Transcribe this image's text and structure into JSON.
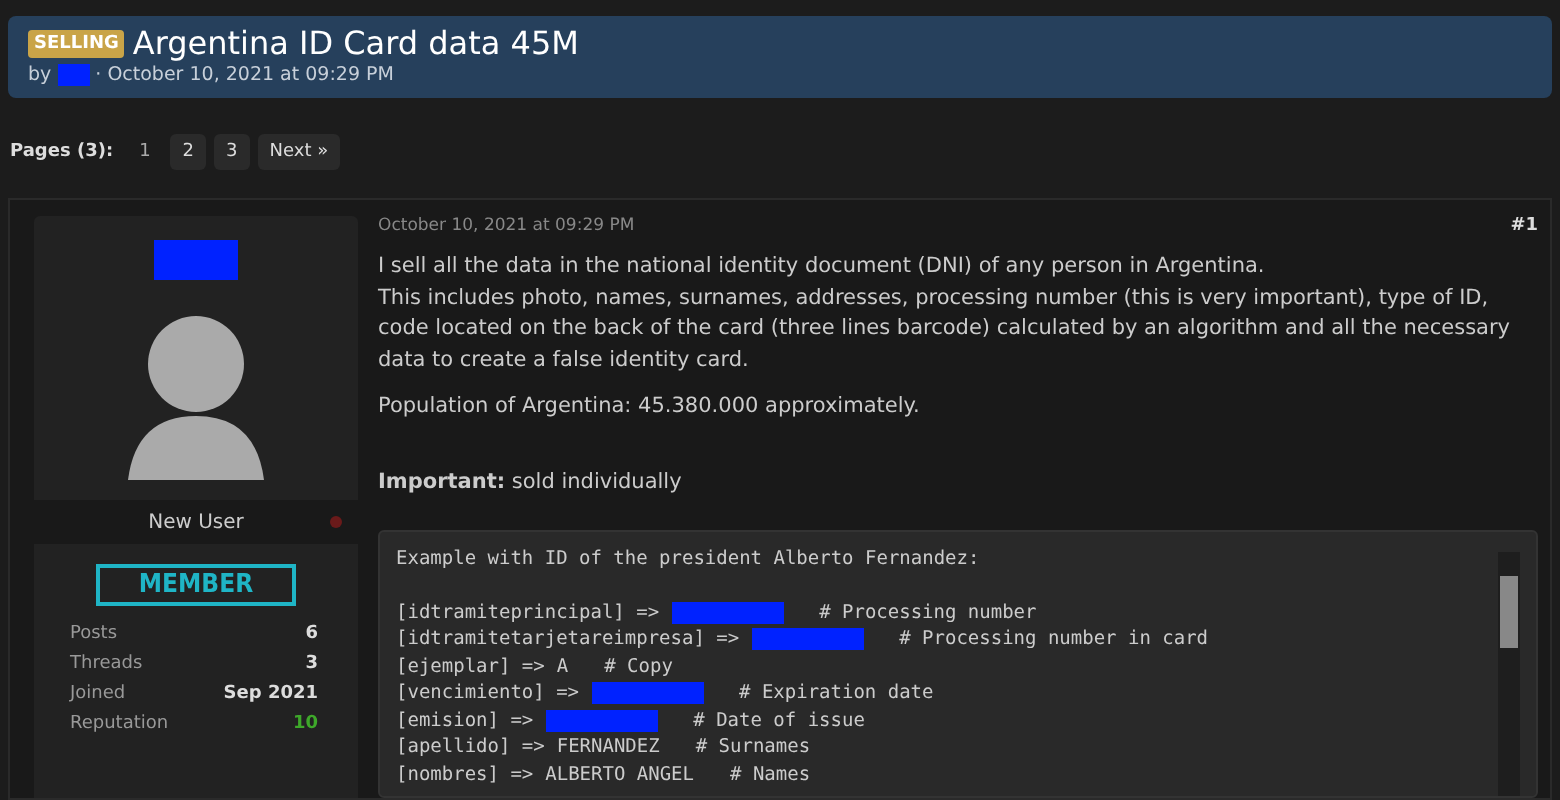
{
  "thread": {
    "prefix": "SELLING",
    "title": "Argentina ID Card data 45M",
    "by": "by",
    "separator": "·",
    "date": "October 10, 2021 at 09:29 PM"
  },
  "pagination": {
    "label": "Pages (3):",
    "pages": [
      {
        "label": "1",
        "selected": true
      },
      {
        "label": "2",
        "selected": false
      },
      {
        "label": "3",
        "selected": false
      }
    ],
    "next": "Next »"
  },
  "author": {
    "rank": "New User",
    "online": false,
    "group": "MEMBER",
    "stats": [
      {
        "label": "Posts",
        "value": "6",
        "kind": "plain"
      },
      {
        "label": "Threads",
        "value": "3",
        "kind": "plain"
      },
      {
        "label": "Joined",
        "value": "Sep 2021",
        "kind": "plain"
      },
      {
        "label": "Reputation",
        "value": "10",
        "kind": "positive"
      }
    ]
  },
  "post": {
    "date": "October 10, 2021 at 09:29 PM",
    "number": "#1",
    "paragraphs": [
      "I sell all the data in the national identity document (DNI) of any person in Argentina.\nThis includes photo, names, surnames, addresses, processing number (this is very important), type of ID, code located on the back of the card (three lines barcode) calculated by an algorithm and all the necessary data to create a false identity card.",
      "Population of Argentina: 45.380.000 approximately.",
      "**Important:** sold individually"
    ],
    "code": {
      "heading": "Example with ID of the president Alberto Fernandez:",
      "lines": [
        {
          "key": "[idtramiteprincipal] =>",
          "kind": "redacted",
          "comment": "# Processing number"
        },
        {
          "key": "[idtramitetarjetareimpresa] =>",
          "kind": "redacted",
          "comment": "# Processing number in card"
        },
        {
          "key": "[ejemplar] =>",
          "kind": "value",
          "value": "A",
          "comment": "# Copy"
        },
        {
          "key": "[vencimiento] =>",
          "kind": "redacted",
          "comment": "# Expiration date"
        },
        {
          "key": "[emision] =>",
          "kind": "redacted",
          "comment": "# Date of issue"
        },
        {
          "key": "[apellido] =>",
          "kind": "value",
          "value": "FERNANDEZ",
          "comment": "# Surnames"
        },
        {
          "key": "[nombres] =>",
          "kind": "value",
          "value": "ALBERTO ANGEL",
          "comment": "# Names"
        }
      ]
    }
  }
}
